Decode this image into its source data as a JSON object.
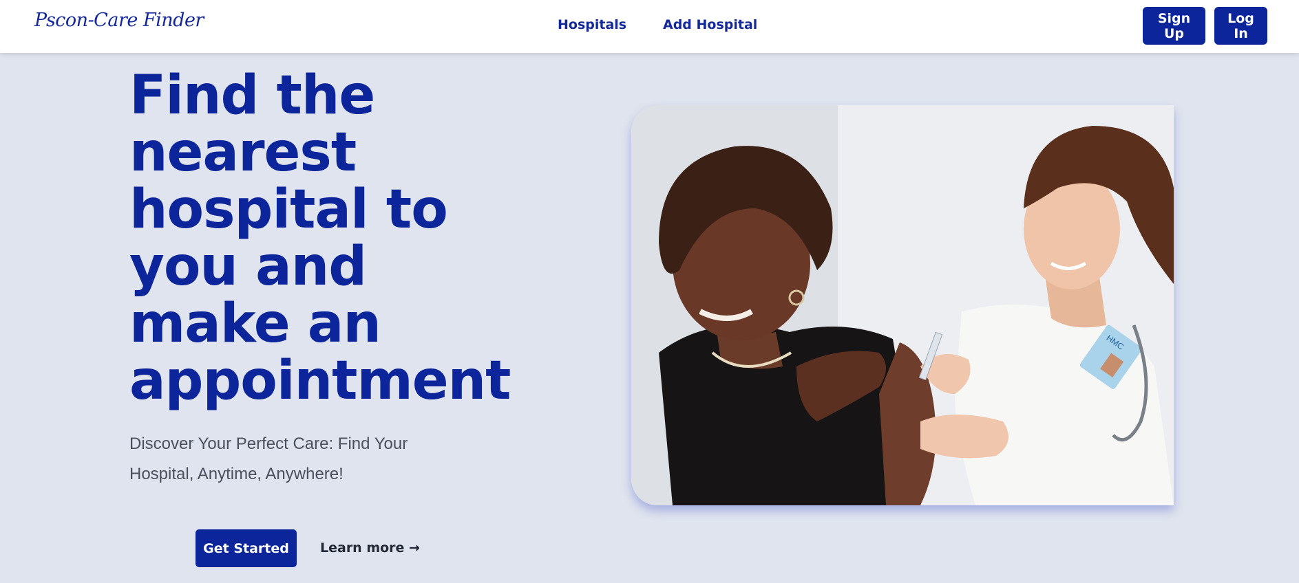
{
  "nav": {
    "logo": "Pscon-Care Finder",
    "links": [
      "Hospitals",
      "Add Hospital"
    ],
    "signup_label": "Sign Up",
    "login_label": "Log In"
  },
  "hero": {
    "title": "Find the nearest hospital to you and make an appointment",
    "subtitle": "Discover Your Perfect Care: Find Your Hospital, Anytime, Anywhere!",
    "get_started_label": "Get Started",
    "learn_more_label": "Learn more →",
    "badge_text": "HMC"
  },
  "colors": {
    "brand": "#0d259a",
    "background": "#e0e4ee",
    "navbar": "#ffffff"
  }
}
